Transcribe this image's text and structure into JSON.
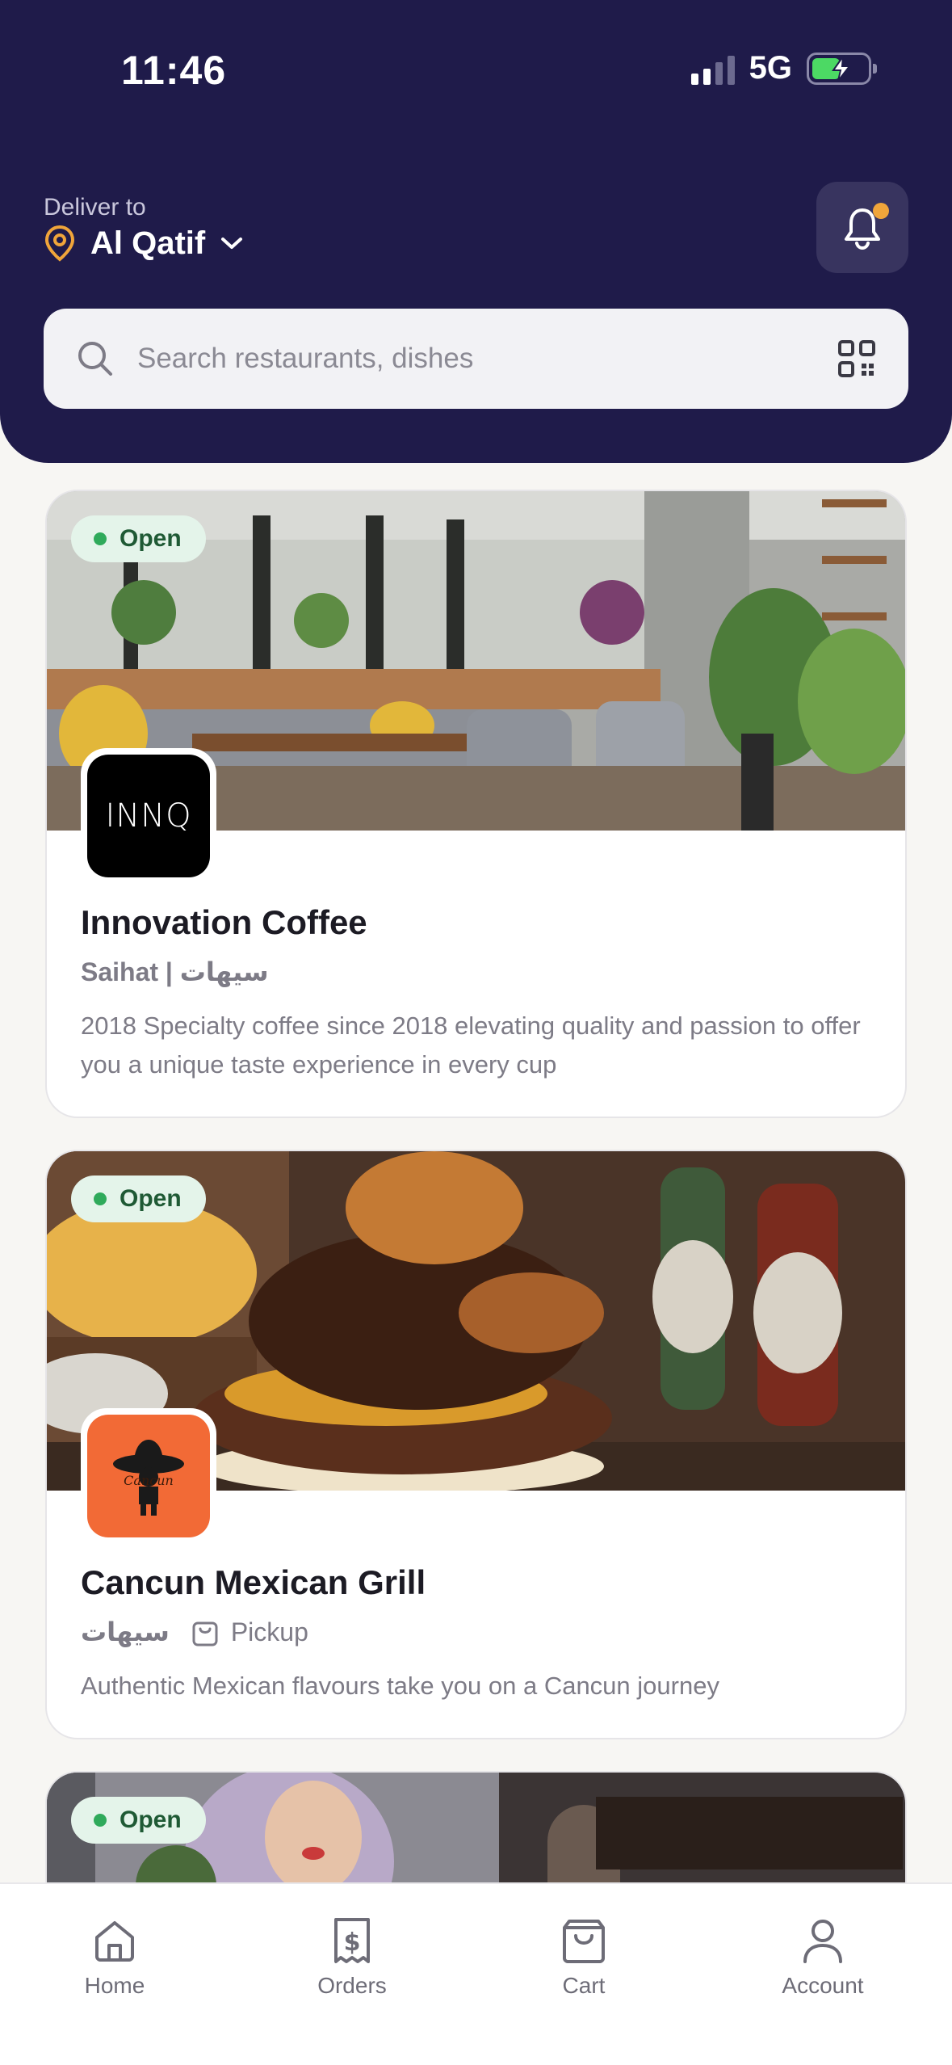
{
  "status": {
    "time": "11:46",
    "network": "5G",
    "battery_level": 0.52
  },
  "header": {
    "deliver_label": "Deliver to",
    "location": "Al Qatif",
    "has_notification": true
  },
  "search": {
    "placeholder": "Search restaurants, dishes"
  },
  "restaurants": [
    {
      "status": "Open",
      "logo_text": "INNQ",
      "name": "Innovation Coffee",
      "location": "Saihat | سيهات",
      "description": "2018 Specialty coffee since 2018 elevating quality and passion to offer you a unique taste experience in every cup"
    },
    {
      "status": "Open",
      "logo_text": "Cancun",
      "name": "Cancun Mexican Grill",
      "location": "سيهات",
      "service": "Pickup",
      "description": "Authentic Mexican flavours take you on a Cancun journey"
    },
    {
      "status": "Open"
    }
  ],
  "nav": [
    {
      "label": "Home",
      "icon": "home-icon"
    },
    {
      "label": "Orders",
      "icon": "receipt-icon"
    },
    {
      "label": "Cart",
      "icon": "bag-icon"
    },
    {
      "label": "Account",
      "icon": "user-icon"
    }
  ],
  "colors": {
    "header_bg": "#1f1b4a",
    "accent": "#f0a53a",
    "open_green": "#2faa5b",
    "cancun_orange": "#f26a36"
  }
}
